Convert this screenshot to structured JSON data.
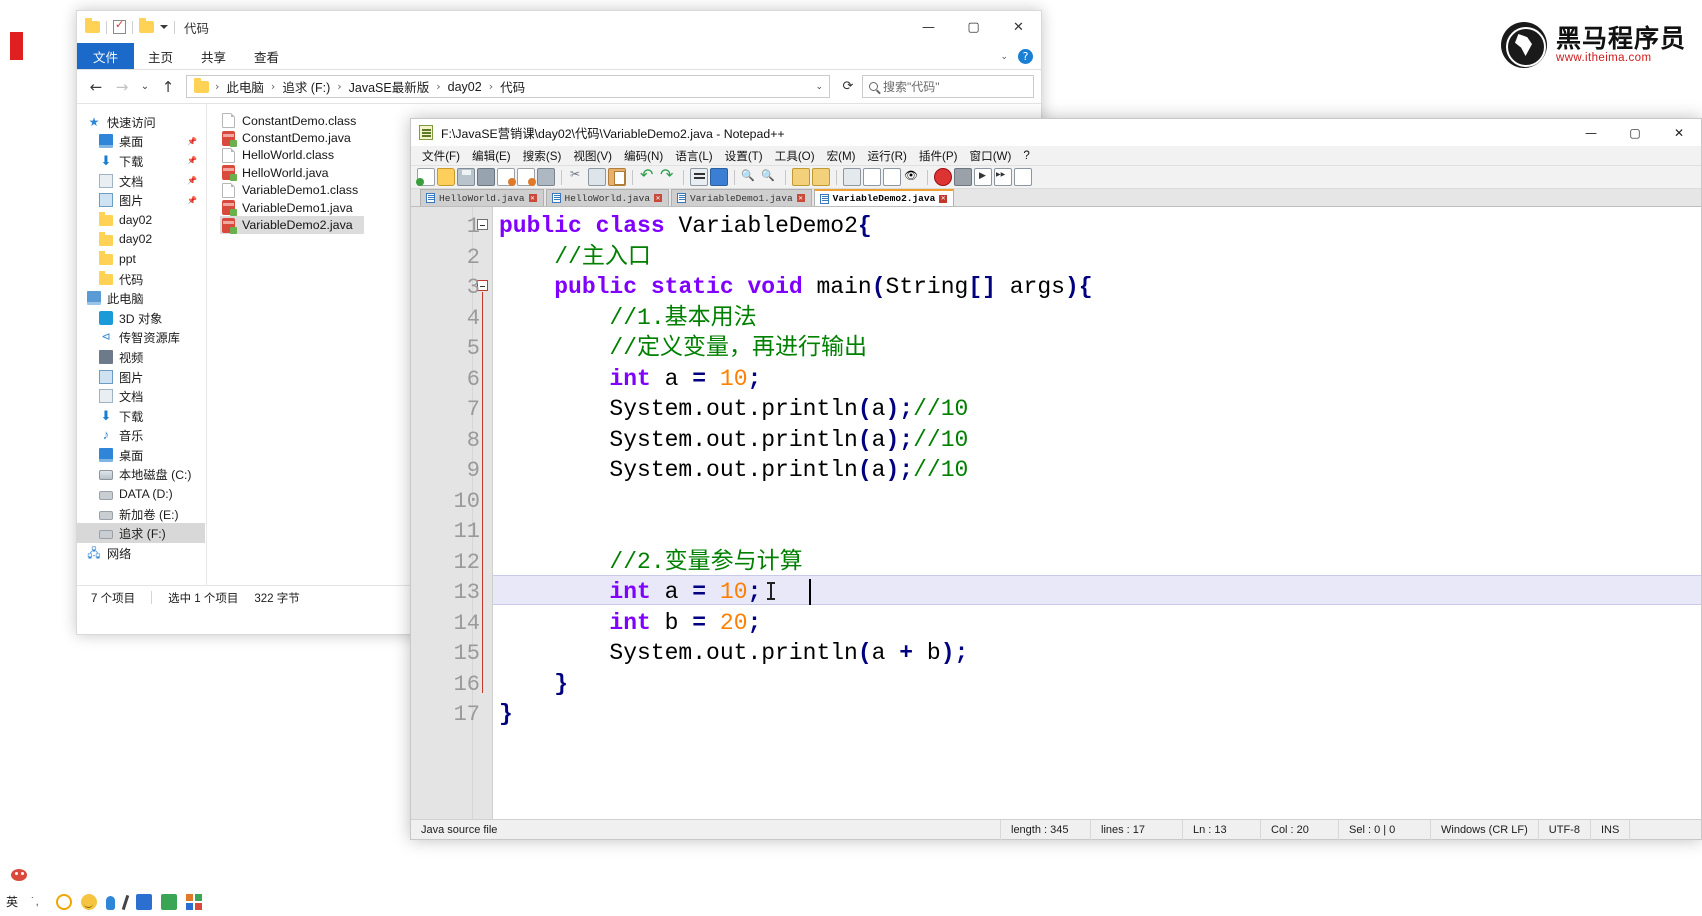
{
  "brand": {
    "logo_name": "heima-logo",
    "name_cn": "黑马程序员",
    "site": "www.itheima.com"
  },
  "explorer": {
    "window_title": "代码",
    "quick_access_tools": [
      "folder-icon",
      "properties-icon",
      "new-folder-icon",
      "customize-caret"
    ],
    "window_controls": {
      "minimize": "—",
      "maximize": "▢",
      "close": "✕"
    },
    "ribbon_tabs": [
      "文件",
      "主页",
      "共享",
      "查看"
    ],
    "ribbon_help": "?",
    "nav": {
      "back": "←",
      "forward": "→",
      "recent": "⌄",
      "up": "↑",
      "refresh": "⟳",
      "address_caret": "⌄"
    },
    "breadcrumbs": [
      "此电脑",
      "追求 (F:)",
      "JavaSE最新版",
      "day02",
      "代码"
    ],
    "search_placeholder": "搜索\"代码\"",
    "tree": [
      {
        "label": "快速访问",
        "icon": "star-icon",
        "level": 1,
        "pinned": false
      },
      {
        "label": "桌面",
        "icon": "desktop-icon",
        "level": 2,
        "pinned": true
      },
      {
        "label": "下载",
        "icon": "download-icon",
        "level": 2,
        "pinned": true
      },
      {
        "label": "文档",
        "icon": "document-icon",
        "level": 2,
        "pinned": true
      },
      {
        "label": "图片",
        "icon": "pictures-icon",
        "level": 2,
        "pinned": true
      },
      {
        "label": "day02",
        "icon": "folder-icon",
        "level": 2,
        "pinned": false
      },
      {
        "label": "day02",
        "icon": "folder-icon",
        "level": 2,
        "pinned": false
      },
      {
        "label": "ppt",
        "icon": "folder-icon",
        "level": 2,
        "pinned": false
      },
      {
        "label": "代码",
        "icon": "folder-icon",
        "level": 2,
        "pinned": false
      },
      {
        "label": "此电脑",
        "icon": "this-pc-icon",
        "level": 1,
        "pinned": false
      },
      {
        "label": "3D 对象",
        "icon": "3d-objects-icon",
        "level": 2,
        "pinned": false
      },
      {
        "label": "传智资源库",
        "icon": "share-icon",
        "level": 2,
        "pinned": false
      },
      {
        "label": "视频",
        "icon": "videos-icon",
        "level": 2,
        "pinned": false
      },
      {
        "label": "图片",
        "icon": "pictures-icon",
        "level": 2,
        "pinned": false
      },
      {
        "label": "文档",
        "icon": "document-icon",
        "level": 2,
        "pinned": false
      },
      {
        "label": "下载",
        "icon": "download-icon",
        "level": 2,
        "pinned": false
      },
      {
        "label": "音乐",
        "icon": "music-icon",
        "level": 2,
        "pinned": false
      },
      {
        "label": "桌面",
        "icon": "desktop-icon",
        "level": 2,
        "pinned": false
      },
      {
        "label": "本地磁盘 (C:)",
        "icon": "system-drive-icon",
        "level": 2,
        "pinned": false
      },
      {
        "label": "DATA (D:)",
        "icon": "drive-icon",
        "level": 2,
        "pinned": false
      },
      {
        "label": "新加卷 (E:)",
        "icon": "drive-icon",
        "level": 2,
        "pinned": false
      },
      {
        "label": "追求 (F:)",
        "icon": "drive-icon",
        "level": 2,
        "pinned": false,
        "selected": true
      },
      {
        "label": "网络",
        "icon": "network-icon",
        "level": 1,
        "pinned": false
      }
    ],
    "files": [
      {
        "name": "ConstantDemo.class",
        "type": "class"
      },
      {
        "name": "ConstantDemo.java",
        "type": "java"
      },
      {
        "name": "HelloWorld.class",
        "type": "class"
      },
      {
        "name": "HelloWorld.java",
        "type": "java"
      },
      {
        "name": "VariableDemo1.class",
        "type": "class"
      },
      {
        "name": "VariableDemo1.java",
        "type": "java"
      },
      {
        "name": "VariableDemo2.java",
        "type": "java",
        "selected": true
      }
    ],
    "status": {
      "count": "7 个项目",
      "selection": "选中 1 个项目",
      "size": "322 字节"
    }
  },
  "notepadpp": {
    "title": "F:\\JavaSE营销课\\day02\\代码\\VariableDemo2.java - Notepad++",
    "window_controls": {
      "minimize": "—",
      "maximize": "▢",
      "close": "✕"
    },
    "menu": [
      "文件(F)",
      "编辑(E)",
      "搜索(S)",
      "视图(V)",
      "编码(N)",
      "语言(L)",
      "设置(T)",
      "工具(O)",
      "宏(M)",
      "运行(R)",
      "插件(P)",
      "窗口(W)",
      "?"
    ],
    "toolbar_icons": [
      "new-file-icon",
      "open-file-icon",
      "save-icon",
      "save-all-icon",
      "close-file-icon",
      "close-all-icon",
      "print-icon",
      "cut-icon",
      "copy-icon",
      "paste-icon",
      "undo-icon",
      "redo-icon",
      "find-icon",
      "replace-icon",
      "zoom-in-icon",
      "zoom-out-icon",
      "sync-vertical-icon",
      "sync-horizontal-icon",
      "word-wrap-icon",
      "all-chars-icon",
      "indent-guide-icon",
      "show-symbol-icon",
      "record-macro-icon",
      "stop-macro-icon",
      "play-macro-icon",
      "fast-play-macro-icon",
      "save-macro-icon"
    ],
    "tabs": [
      {
        "label": "HelloWorld.java",
        "active": false
      },
      {
        "label": "HelloWorld.java",
        "active": false
      },
      {
        "label": "VariableDemo1.java",
        "active": false
      },
      {
        "label": "VariableDemo2.java",
        "active": true
      }
    ],
    "code": {
      "line_numbers": [
        1,
        2,
        3,
        4,
        5,
        6,
        7,
        8,
        9,
        10,
        11,
        12,
        13,
        14,
        15,
        16,
        17
      ],
      "lines": [
        {
          "n": 1,
          "tokens": [
            {
              "t": "public ",
              "c": "kw"
            },
            {
              "t": "class ",
              "c": "kw"
            },
            {
              "t": "VariableDemo2",
              "c": "cls"
            },
            {
              "t": "{",
              "c": "br"
            }
          ]
        },
        {
          "n": 2,
          "tokens": [
            {
              "t": "    //主入口",
              "c": "cmt"
            }
          ]
        },
        {
          "n": 3,
          "tokens": [
            {
              "t": "    ",
              "c": "pl"
            },
            {
              "t": "public ",
              "c": "kw"
            },
            {
              "t": "static ",
              "c": "kw"
            },
            {
              "t": "void ",
              "c": "kw"
            },
            {
              "t": "main",
              "c": "cls"
            },
            {
              "t": "(",
              "c": "br"
            },
            {
              "t": "String",
              "c": "cls"
            },
            {
              "t": "[]",
              "c": "br"
            },
            {
              "t": " args",
              "c": "cls"
            },
            {
              "t": "){",
              "c": "br"
            }
          ]
        },
        {
          "n": 4,
          "tokens": [
            {
              "t": "        //1.基本用法",
              "c": "cmt"
            }
          ]
        },
        {
          "n": 5,
          "tokens": [
            {
              "t": "        //定义变量，再进行输出",
              "c": "cmt"
            }
          ]
        },
        {
          "n": 6,
          "tokens": [
            {
              "t": "        ",
              "c": "pl"
            },
            {
              "t": "int",
              "c": "kw"
            },
            {
              "t": " a ",
              "c": "cls"
            },
            {
              "t": "=",
              "c": "op"
            },
            {
              "t": " ",
              "c": "pl"
            },
            {
              "t": "10",
              "c": "num"
            },
            {
              "t": ";",
              "c": "op"
            }
          ]
        },
        {
          "n": 7,
          "tokens": [
            {
              "t": "        System.out.println",
              "c": "cls"
            },
            {
              "t": "(",
              "c": "br"
            },
            {
              "t": "a",
              "c": "cls"
            },
            {
              "t": ");",
              "c": "br"
            },
            {
              "t": "//10",
              "c": "cmt"
            }
          ]
        },
        {
          "n": 8,
          "tokens": [
            {
              "t": "        System.out.println",
              "c": "cls"
            },
            {
              "t": "(",
              "c": "br"
            },
            {
              "t": "a",
              "c": "cls"
            },
            {
              "t": ");",
              "c": "br"
            },
            {
              "t": "//10",
              "c": "cmt"
            }
          ]
        },
        {
          "n": 9,
          "tokens": [
            {
              "t": "        System.out.println",
              "c": "cls"
            },
            {
              "t": "(",
              "c": "br"
            },
            {
              "t": "a",
              "c": "cls"
            },
            {
              "t": ");",
              "c": "br"
            },
            {
              "t": "//10",
              "c": "cmt"
            }
          ]
        },
        {
          "n": 10,
          "tokens": []
        },
        {
          "n": 11,
          "tokens": []
        },
        {
          "n": 12,
          "tokens": [
            {
              "t": "        //2.变量参与计算",
              "c": "cmt"
            }
          ]
        },
        {
          "n": 13,
          "tokens": [
            {
              "t": "        ",
              "c": "pl"
            },
            {
              "t": "int",
              "c": "kw"
            },
            {
              "t": " a ",
              "c": "cls"
            },
            {
              "t": "=",
              "c": "op"
            },
            {
              "t": " ",
              "c": "pl"
            },
            {
              "t": "10",
              "c": "num"
            },
            {
              "t": ";",
              "c": "op"
            }
          ],
          "highlighted": true
        },
        {
          "n": 14,
          "tokens": [
            {
              "t": "        ",
              "c": "pl"
            },
            {
              "t": "int",
              "c": "kw"
            },
            {
              "t": " b ",
              "c": "cls"
            },
            {
              "t": "=",
              "c": "op"
            },
            {
              "t": " ",
              "c": "pl"
            },
            {
              "t": "20",
              "c": "num"
            },
            {
              "t": ";",
              "c": "op"
            }
          ]
        },
        {
          "n": 15,
          "tokens": [
            {
              "t": "        System.out.println",
              "c": "cls"
            },
            {
              "t": "(",
              "c": "br"
            },
            {
              "t": "a ",
              "c": "cls"
            },
            {
              "t": "+",
              "c": "op"
            },
            {
              "t": " b",
              "c": "cls"
            },
            {
              "t": ");",
              "c": "br"
            }
          ]
        },
        {
          "n": 16,
          "tokens": [
            {
              "t": "    ",
              "c": "pl"
            },
            {
              "t": "}",
              "c": "br"
            }
          ]
        },
        {
          "n": 17,
          "tokens": [
            {
              "t": "}",
              "c": "br"
            }
          ]
        }
      ]
    },
    "status": {
      "file_type": "Java source file",
      "length_label": "length : 345",
      "lines_label": "lines : 17",
      "ln": "Ln : 13",
      "col": "Col : 20",
      "sel": "Sel : 0 | 0",
      "eol": "Windows (CR LF)",
      "encoding": "UTF-8",
      "ins": "INS"
    }
  },
  "colors": {
    "keyword": "#8000ff",
    "comment": "#008000",
    "number": "#ff8000",
    "operator": "#000080",
    "accent_tab": "#f0a030",
    "explorer_file_tab": "#1b6ac9",
    "brand_red": "#d01b1b"
  },
  "taskbar": {
    "icons": [
      "ime-chinese-icon",
      "dots-icon",
      "emoji-icon",
      "smiley-icon",
      "mic-icon",
      "pen-icon",
      "blue-app-icon",
      "green-app-icon",
      "grid-apps-icon"
    ],
    "ime_label": "英"
  }
}
